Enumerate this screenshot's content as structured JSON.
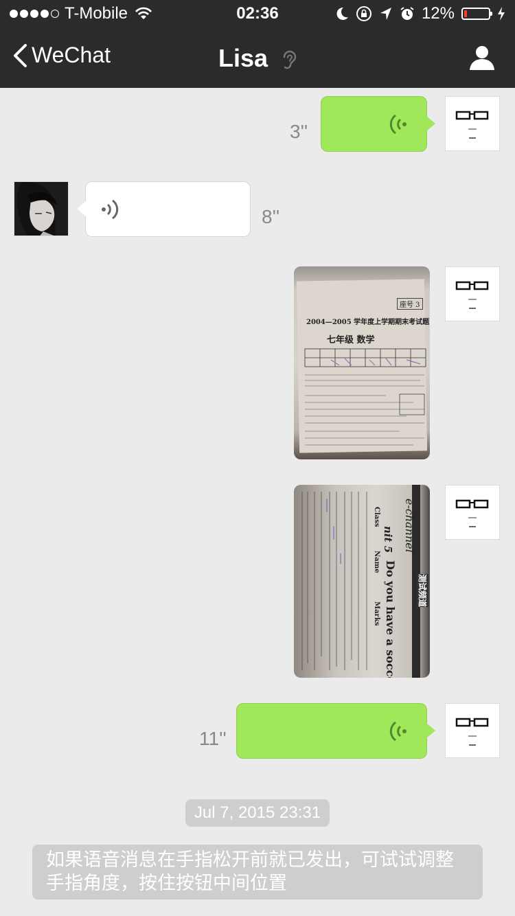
{
  "status_bar": {
    "carrier": "T-Mobile",
    "time": "02:36",
    "battery": "12%",
    "battery_level": 0.12,
    "signal_bars": 4
  },
  "nav": {
    "back_label": "WeChat",
    "title": "Lisa",
    "ear_icon": "ear-icon",
    "profile_icon": "person-icon"
  },
  "messages": [
    {
      "type": "voice",
      "sender": "me",
      "duration": "3''"
    },
    {
      "type": "voice",
      "sender": "Lisa",
      "duration": "8''"
    },
    {
      "type": "image",
      "sender": "me",
      "text_lines": [
        "座号 3",
        "2004—2005 学年度上学期期末考试题",
        "七年级 数学"
      ]
    },
    {
      "type": "image",
      "sender": "me",
      "text_lines": [
        "e-channel",
        "nit 5",
        "Do you have a soccer ball?",
        "Class",
        "Name",
        "Marks",
        "测试频道"
      ]
    },
    {
      "type": "voice",
      "sender": "me",
      "duration": "11''"
    }
  ],
  "timestamp": "Jul 7, 2015 23:31",
  "system_message": "如果语音消息在手指松开前就已发出，可试试调整手指角度，按住按钮中间位置",
  "colors": {
    "nav_bg": "#2b2b2d",
    "chat_bg": "#ebebeb",
    "my_bubble": "#a0e75a",
    "their_bubble": "#ffffff",
    "system_bg": "#cecece"
  }
}
